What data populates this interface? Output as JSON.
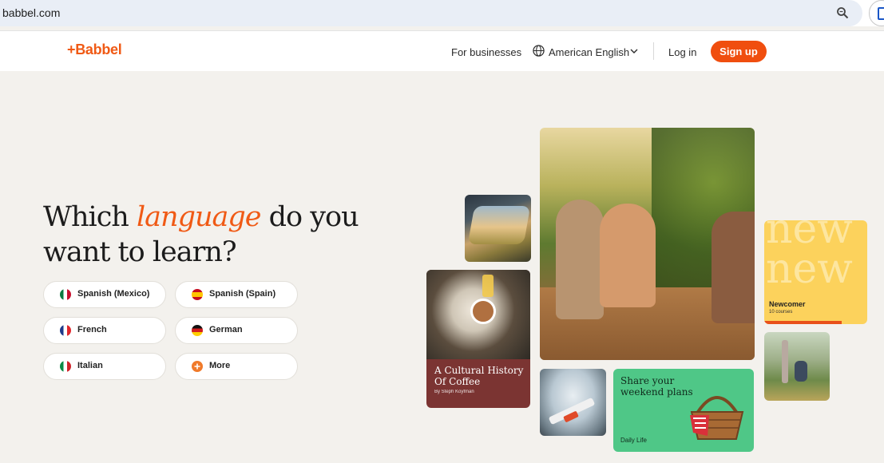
{
  "browser": {
    "url": "babbel.com"
  },
  "header": {
    "logo": "+Babbel",
    "for_businesses": "For businesses",
    "language": "American English",
    "login": "Log in",
    "signup": "Sign up"
  },
  "hero": {
    "headline_pre": "Which ",
    "headline_em": "language",
    "headline_post": " do you want to learn?",
    "languages": [
      {
        "label": "Spanish (Mexico)",
        "flag": "mexico-flag"
      },
      {
        "label": "Spanish (Spain)",
        "flag": "spain-flag"
      },
      {
        "label": "French",
        "flag": "france-flag"
      },
      {
        "label": "German",
        "flag": "germany-flag"
      },
      {
        "label": "Italian",
        "flag": "italy-flag"
      },
      {
        "label": "More",
        "flag": "plus-icon"
      }
    ]
  },
  "cards": {
    "coffee_title": "A Cultural History Of Coffee",
    "coffee_author": "By Steph Koyfman",
    "newcomer_bg": "new new",
    "newcomer_title": "Newcomer",
    "newcomer_sub": "10 courses",
    "weekend_title": "Share your weekend plans",
    "weekend_tag": "Daily Life"
  },
  "colors": {
    "brand": "#f05a15",
    "signup": "#f04e0f",
    "background": "#f3f1ed",
    "coffee_card": "#7b3432",
    "newcomer_card": "#fcd25c",
    "weekend_card": "#4fc787"
  }
}
